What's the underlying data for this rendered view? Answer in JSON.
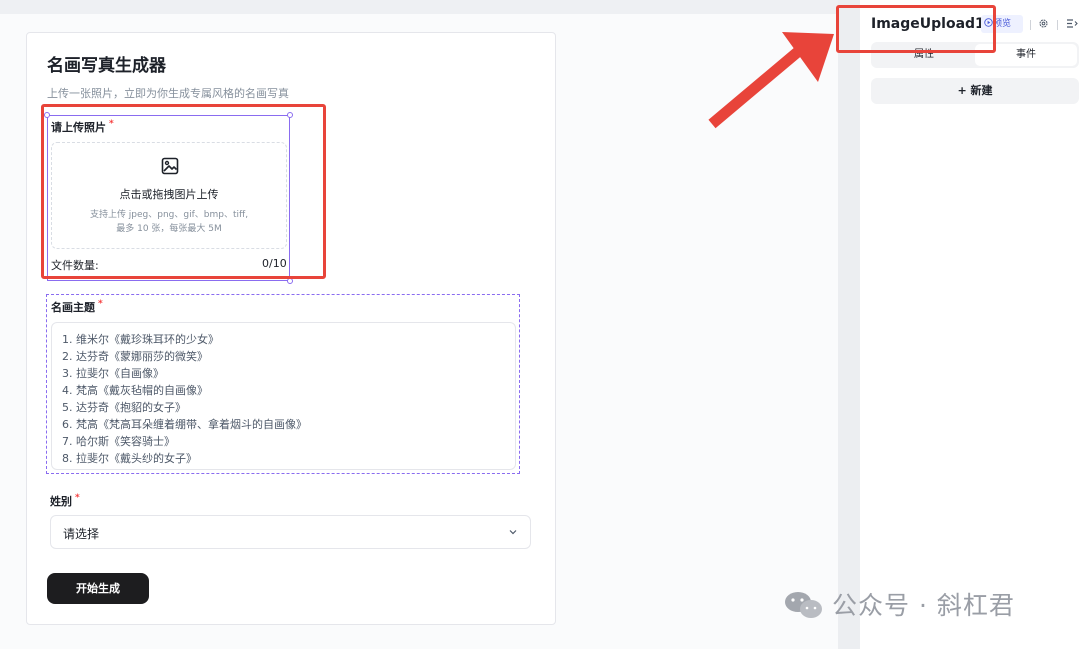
{
  "form": {
    "title": "名画写真生成器",
    "subtitle": "上传一张照片，立即为你生成专属风格的名画写真",
    "upload": {
      "label": "请上传照片",
      "required_mark": "*",
      "main_text": "点击或拖拽图片上传",
      "hint_line1": "支持上传 jpeg、png、gif、bmp、tiff,",
      "hint_line2": "最多 10 张，每张最大 5M",
      "file_count_label": "文件数量:",
      "file_count_value": "0/10"
    },
    "theme": {
      "label": "名画主题",
      "required_mark": "*",
      "lines": [
        "1. 维米尔《戴珍珠耳环的少女》",
        "2. 达芬奇《蒙娜丽莎的微笑》",
        "3. 拉斐尔《自画像》",
        "4. 梵高《戴灰毡帽的自画像》",
        "5. 达芬奇《抱貂的女子》",
        "6. 梵高《梵高耳朵缠着绷带、拿着烟斗的自画像》",
        "7. 哈尔斯《笑容骑士》",
        "8. 拉斐尔《戴头纱的女子》"
      ]
    },
    "gender": {
      "label": "姓别",
      "required_mark": "*",
      "select_value": "请选择"
    },
    "submit_label": "开始生成"
  },
  "panel": {
    "component_name": "ImageUpload1",
    "preview_label": "预览",
    "tabs": [
      {
        "label": "属性"
      },
      {
        "label": "事件"
      }
    ],
    "new_label": "+  新建"
  },
  "watermark": {
    "text": "公众号 · 斜杠君"
  },
  "colors": {
    "annotation_red": "#e8443a",
    "selection_purple": "#8a6cf0",
    "primary_button": "#1d1d1f"
  }
}
